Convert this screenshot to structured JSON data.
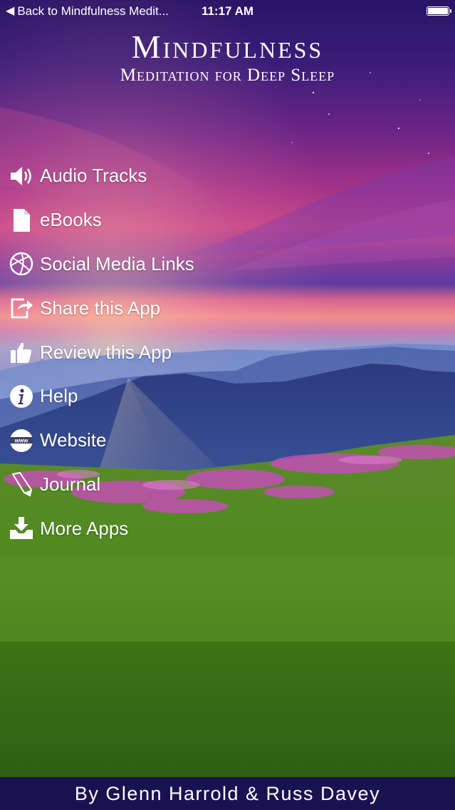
{
  "status_bar": {
    "back_label": "Back to Mindfulness Medit...",
    "time": "11:17 AM",
    "battery_level": 1.0
  },
  "header": {
    "title": "Mindfulness",
    "subtitle": "Meditation for Deep Sleep"
  },
  "menu": {
    "items": [
      {
        "label": "Audio Tracks",
        "icon": "speaker-icon"
      },
      {
        "label": "eBooks",
        "icon": "document-icon"
      },
      {
        "label": "Social Media Links",
        "icon": "globe-ball-icon"
      },
      {
        "label": "Share this App",
        "icon": "share-icon"
      },
      {
        "label": "Review this App",
        "icon": "thumbs-up-icon"
      },
      {
        "label": "Help",
        "icon": "info-icon"
      },
      {
        "label": "Website",
        "icon": "www-icon"
      },
      {
        "label": "Journal",
        "icon": "pencil-icon"
      },
      {
        "label": "More Apps",
        "icon": "download-tray-icon"
      }
    ]
  },
  "footer": {
    "credit": "By Glenn Harrold & Russ Davey"
  },
  "colors": {
    "footer_bg": "#1a1250",
    "text": "#ffffff"
  }
}
